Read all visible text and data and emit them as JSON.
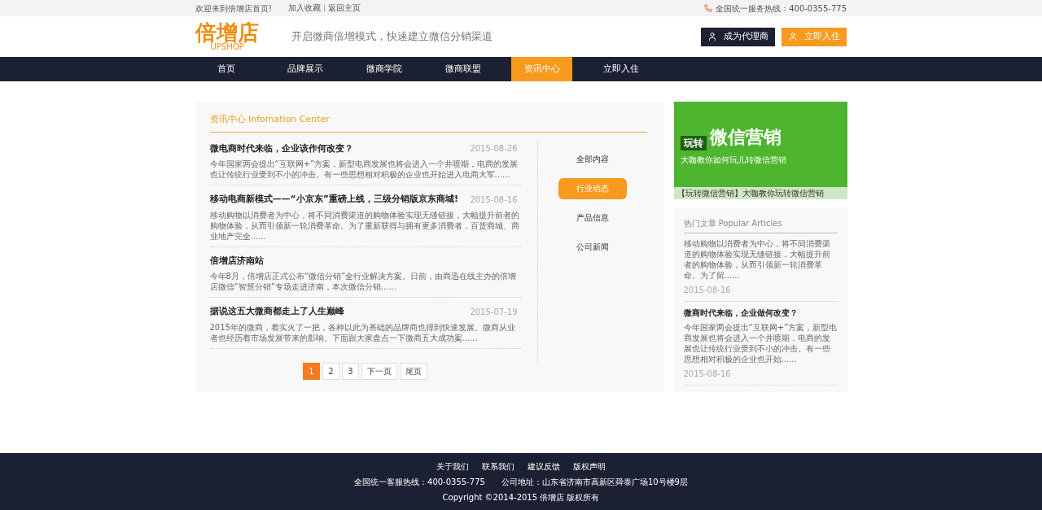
{
  "topbar": {
    "welcome": "欢迎来到倍增店首页!",
    "links": [
      "加入收藏",
      "返回主页"
    ],
    "hotline": "全国统一服务热线：400-0355-775"
  },
  "header": {
    "logo": "倍增店",
    "logo_sub": "UPSHOP",
    "slogan": "开启微商倍增模式，快速建立微信分销渠道",
    "buttons": [
      {
        "label": "成为代理商",
        "kind": "dark"
      },
      {
        "label": "立即入住",
        "kind": "orange"
      }
    ]
  },
  "nav": [
    {
      "label": "首页",
      "selected": false
    },
    {
      "label": "品牌展示",
      "selected": false
    },
    {
      "label": "微商学院",
      "selected": false
    },
    {
      "label": "微商联盟",
      "selected": false
    },
    {
      "label": "资讯中心",
      "selected": true
    },
    {
      "label": "立即入住",
      "selected": false
    }
  ],
  "news": {
    "title": "资讯中心 Infomation Center",
    "articles": [
      {
        "title": "微电商时代来临，企业该作何改变？",
        "date": "2015-08-26",
        "summary": "今年国家两会提出“互联网+”方案，新型电商发展也将会进入一个井喷期，电商的发展也让传统行业受到不小的冲击。有一些思想相对积极的企业也开始进入电商大军......"
      },
      {
        "title": "移动电商新模式——“小京东”重磅上线，三级分销版京东商城!",
        "date": "2015-08-16",
        "summary": "移动购物以消费者为中心，将不同消费渠道的购物体验实现无缝链接，大幅提升前者的购物体验，从而引领新一轮消费革命。为了重新获得与拥有更多消费者，百货商城、商业地产完全......"
      },
      {
        "title": "倍增店济南站",
        "summary": "今年8月，倍增店正式公布“微信分销”全行业解决方案。日前，由商迅在线主办的倍增店微信“智慧分销”专场走进济南，本次微信分销......"
      },
      {
        "title": "据说这五大微商都走上了人生巅峰",
        "date": "2015-07-19",
        "summary": "2015年的微商，着实火了一把，各种以此为基础的品牌商也得到快速发展。微商从业者也经历着市场发展带来的影响。下面跟大家盘点一下微商五大成功案......"
      }
    ],
    "pagination": [
      {
        "label": "1",
        "selected": true
      },
      {
        "label": "2",
        "selected": false
      },
      {
        "label": "3",
        "selected": false
      },
      {
        "label": "下一页",
        "selected": false
      },
      {
        "label": "尾页",
        "selected": false
      }
    ],
    "categories": [
      {
        "label": "全部内容",
        "selected": false
      },
      {
        "label": "行业动态",
        "selected": true
      },
      {
        "label": "产品信息",
        "selected": false
      },
      {
        "label": "公司新闻",
        "selected": false
      }
    ]
  },
  "sidebar": {
    "banner_title": "玩转",
    "banner_big": "微信营销",
    "banner_sub": "大咖教你如何玩儿转微信营销",
    "banner_caption": "【玩转微信营销】大咖教你玩转微信营销",
    "popular_title": "热门文章  Popular Articles",
    "articles": [
      {
        "summary": "移动购物以消费者为中心，将不同消费渠道的购物体验实现无缝链接，大幅提升前者的购物体验，从而引领新一轮消费革命。为了留......",
        "date": "2015-08-16"
      },
      {
        "title": "微商时代来临，企业做何改变？",
        "summary": "今年国家两会提出“互联网+”方案，新型电商发展也将会进入一个井喷期，电商的发展也让传统行业受到不小的冲击。有一些思想相对积极的企业也开始......",
        "date": "2015-08-16"
      }
    ]
  },
  "footer": {
    "links": [
      "关于我们",
      "联系我们",
      "建议反馈",
      "版权声明"
    ],
    "hotline": "全国统一客服热线：400-0355-775",
    "address": "公司地址：山东省济南市高新区舜泰广场10号楼9层",
    "copyright": "Copyright ©2014-2015 倍增店  版权所有"
  }
}
